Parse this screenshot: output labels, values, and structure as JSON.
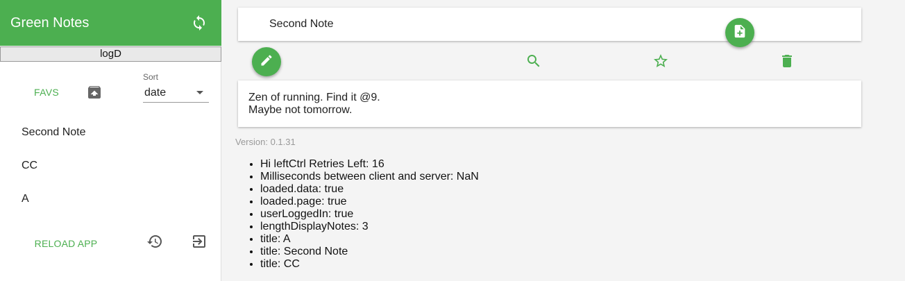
{
  "app": {
    "title": "Green Notes",
    "username": "logD",
    "accent_color": "#4caf50"
  },
  "sidebar": {
    "favs_label": "FAVS",
    "sort": {
      "label": "Sort",
      "value": "date"
    },
    "notes": [
      {
        "title": "Second Note"
      },
      {
        "title": "CC"
      },
      {
        "title": "A"
      }
    ],
    "reload_label": "RELOAD APP"
  },
  "icons": {
    "sync": "sync-icon",
    "archive": "archive-icon",
    "history": "history-icon",
    "logout": "logout-icon",
    "add_note": "note-add-icon",
    "edit": "pencil-icon",
    "search": "search-icon",
    "star": "star-outline-icon",
    "delete": "trash-icon"
  },
  "main": {
    "note_title": "Second Note",
    "content_lines": [
      "Zen of running. Find it @9.",
      "Maybe not tomorrow."
    ],
    "version": "Version: 0.1.31",
    "debug": [
      "Hi leftCtrl Retries Left: 16",
      "Milliseconds between client and server: NaN",
      "loaded.data: true",
      "loaded.page: true",
      "userLoggedIn: true",
      "lengthDisplayNotes: 3",
      "title: A",
      "title: Second Note",
      "title: CC"
    ]
  }
}
